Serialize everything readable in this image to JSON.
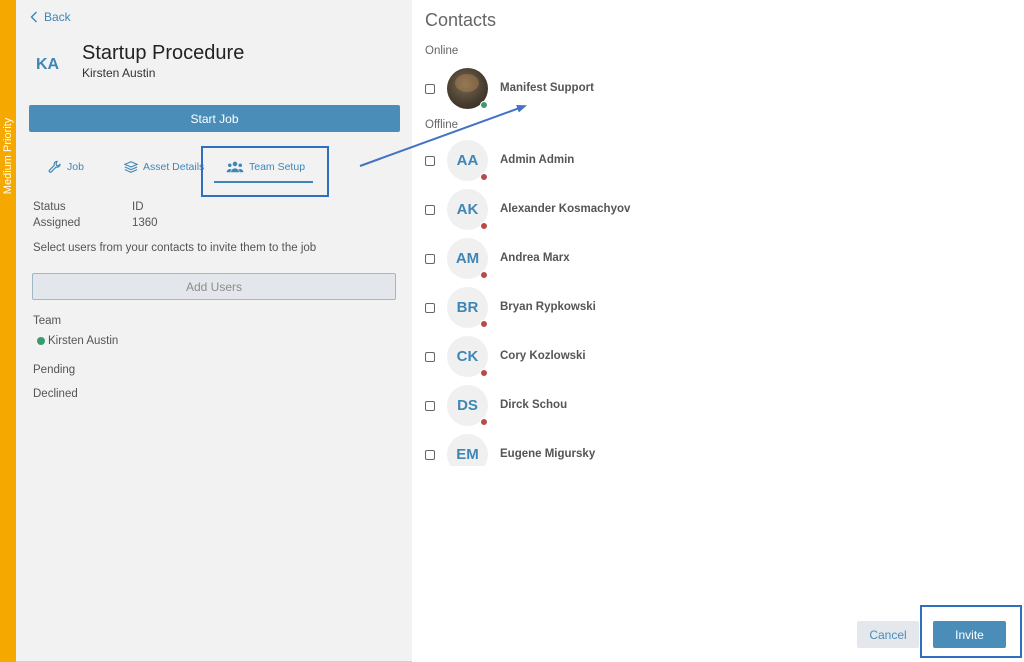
{
  "priority": {
    "label": "Medium Priority",
    "color": "#f5a800"
  },
  "header": {
    "back_label": "Back",
    "initials": "KA",
    "title": "Startup Procedure",
    "owner": "Kirsten Austin"
  },
  "actions": {
    "start_job_label": "Start Job"
  },
  "tabs": [
    {
      "label": "Job",
      "icon": "wrench-icon"
    },
    {
      "label": "Asset Details",
      "icon": "layers-icon"
    },
    {
      "label": "Team Setup",
      "icon": "team-icon",
      "active": true
    }
  ],
  "info": {
    "status_label": "Status",
    "status_value": "ID",
    "assigned_label": "Assigned",
    "assigned_value": "1360"
  },
  "hint": "Select users from your contacts to invite them to the job",
  "add_users_label": "Add Users",
  "team": {
    "team_label": "Team",
    "members": [
      {
        "name": "Kirsten Austin",
        "status": "online"
      }
    ],
    "pending_label": "Pending",
    "declined_label": "Declined"
  },
  "contacts": {
    "title": "Contacts",
    "online_label": "Online",
    "offline_label": "Offline",
    "online": [
      {
        "name": "Manifest Support",
        "photo": true,
        "status": "online"
      }
    ],
    "offline": [
      {
        "initials": "AA",
        "name": "Admin Admin",
        "status": "offline"
      },
      {
        "initials": "AK",
        "name": "Alexander Kosmachyov",
        "status": "offline"
      },
      {
        "initials": "AM",
        "name": "Andrea Marx",
        "status": "offline"
      },
      {
        "initials": "BR",
        "name": "Bryan Rypkowski",
        "status": "offline"
      },
      {
        "initials": "CK",
        "name": "Cory Kozlowski",
        "status": "offline"
      },
      {
        "initials": "DS",
        "name": "Dirck Schou",
        "status": "offline"
      },
      {
        "initials": "EM",
        "name": "Eugene Migursky",
        "status": "offline"
      }
    ]
  },
  "footer": {
    "cancel_label": "Cancel",
    "invite_label": "Invite"
  },
  "colors": {
    "accent": "#4a8db8",
    "link": "#3e86b5",
    "online": "#3a9a6e",
    "offline": "#b94a4a",
    "annotation": "#2e6fc0"
  }
}
